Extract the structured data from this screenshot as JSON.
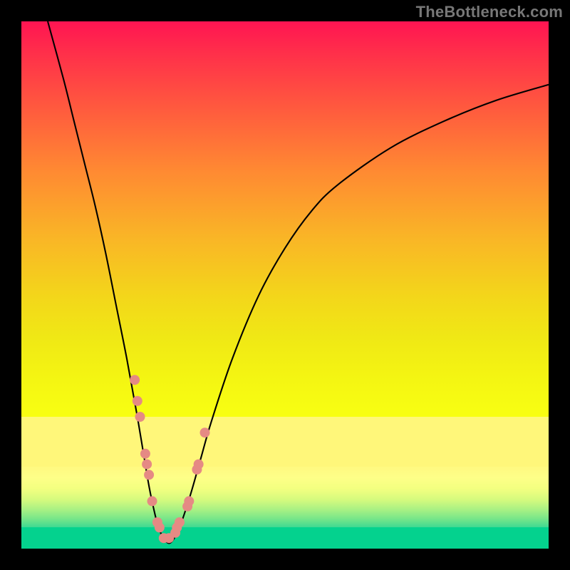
{
  "watermark": {
    "text": "TheBottleneck.com"
  },
  "chart_data": {
    "type": "line",
    "title": "",
    "xlabel": "",
    "ylabel": "",
    "xlim": [
      0,
      100
    ],
    "ylim": [
      0,
      100
    ],
    "series": [
      {
        "name": "curve",
        "x": [
          5,
          8,
          10,
          12,
          14,
          16,
          18,
          20,
          22,
          24,
          25,
          26,
          27,
          28,
          29,
          30,
          32,
          34,
          36,
          40,
          45,
          50,
          55,
          60,
          70,
          80,
          90,
          100
        ],
        "y": [
          100,
          89,
          81,
          73,
          65,
          56,
          46,
          36,
          25,
          13,
          8,
          4,
          2,
          1,
          2,
          4,
          10,
          17,
          24,
          36,
          48,
          57,
          64,
          69,
          76,
          81,
          85,
          88
        ]
      }
    ],
    "highlight_points": {
      "name": "data-dots",
      "x": [
        21.5,
        22,
        22.5,
        23.5,
        23.8,
        24.2,
        24.8,
        25.8,
        26.2,
        27.0,
        28.0,
        29.2,
        29.5,
        30.0,
        31.5,
        31.8,
        33.3,
        33.6,
        34.8
      ],
      "y": [
        32,
        28,
        25,
        18,
        16,
        14,
        9,
        5,
        4,
        2,
        2,
        3,
        4,
        5,
        8,
        9,
        15,
        16,
        22
      ],
      "color": "#e58a84",
      "r": 7
    },
    "background_bands": [
      {
        "from_y": 100,
        "to_y": 25,
        "style": "red-yellow-gradient"
      },
      {
        "from_y": 25,
        "to_y": 16,
        "style": "pale-yellow"
      },
      {
        "from_y": 16,
        "to_y": 4,
        "style": "yellow-green-gradient"
      },
      {
        "from_y": 4,
        "to_y": 0,
        "style": "green"
      }
    ],
    "notes": "V-shaped bottleneck curve; minimum near x≈27 at y≈1. Values are estimates read from an unlabeled axisless plot."
  }
}
